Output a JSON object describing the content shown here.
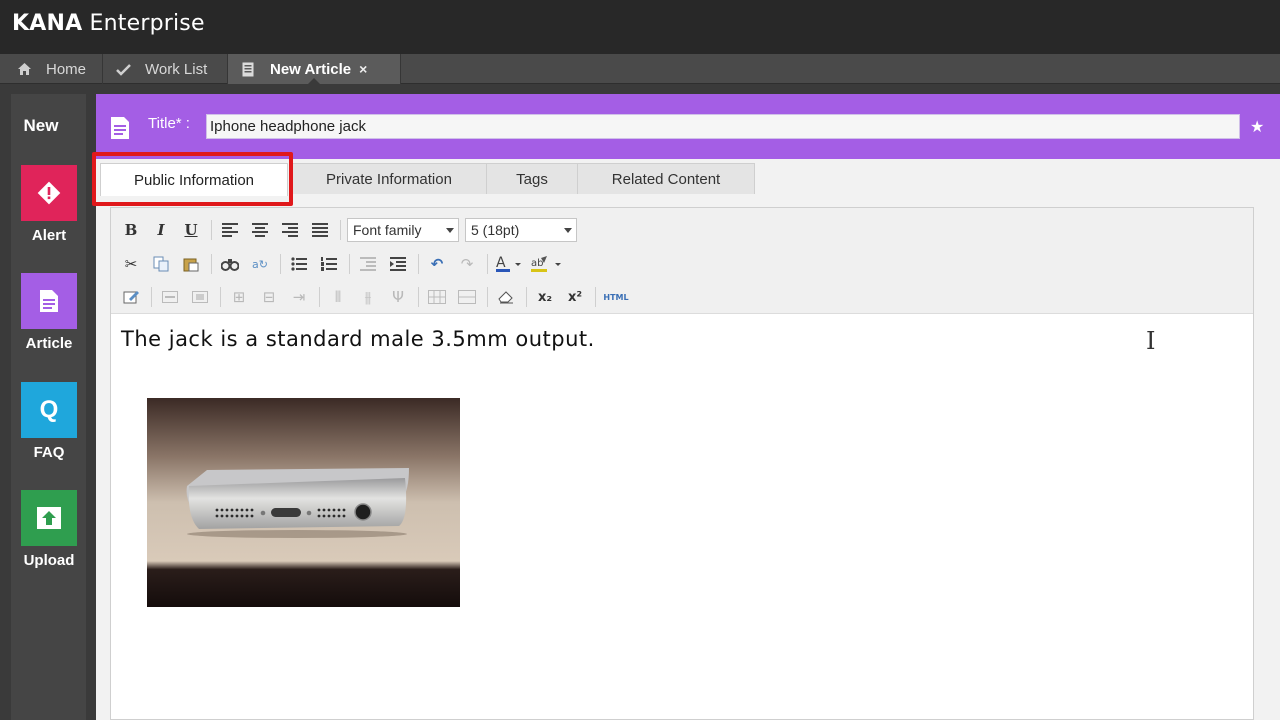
{
  "app": {
    "brand_bold": "KANA",
    "brand_light": "Enterprise"
  },
  "nav_tabs": [
    {
      "label": "Home",
      "icon": "home-icon"
    },
    {
      "label": "Work List",
      "icon": "check-icon"
    },
    {
      "label": "New Article",
      "icon": "document-icon",
      "active": true,
      "close": "×"
    }
  ],
  "sidebar": {
    "heading": "New",
    "items": [
      {
        "label": "Alert",
        "icon": "alert-icon",
        "color": "#e0245a"
      },
      {
        "label": "Article",
        "icon": "article-icon",
        "color": "#a45ee5"
      },
      {
        "label": "FAQ",
        "icon": "faq-icon",
        "glyph": "Q",
        "color": "#1fa7dc"
      },
      {
        "label": "Upload",
        "icon": "upload-icon",
        "color": "#2f9e4f"
      }
    ]
  },
  "article": {
    "title_label": "Title* :",
    "title_value": "Iphone headphone jack",
    "accent_color": "#a45ee5"
  },
  "content_tabs": [
    {
      "label": "Public Information",
      "active": true
    },
    {
      "label": "Private Information"
    },
    {
      "label": "Tags"
    },
    {
      "label": "Related Content"
    }
  ],
  "toolbar": {
    "font_family": "Font family",
    "font_size": "5 (18pt)",
    "bold": "B",
    "italic": "I",
    "underline": "U",
    "subscript": "x₂",
    "superscript": "x²",
    "html": "HTML"
  },
  "editor": {
    "body_text": "The jack is a standard male 3.5mm output.",
    "image": "iPhone bottom edge photo"
  },
  "colors": {
    "highlight": "#e0181b",
    "topbar": "#282828"
  }
}
